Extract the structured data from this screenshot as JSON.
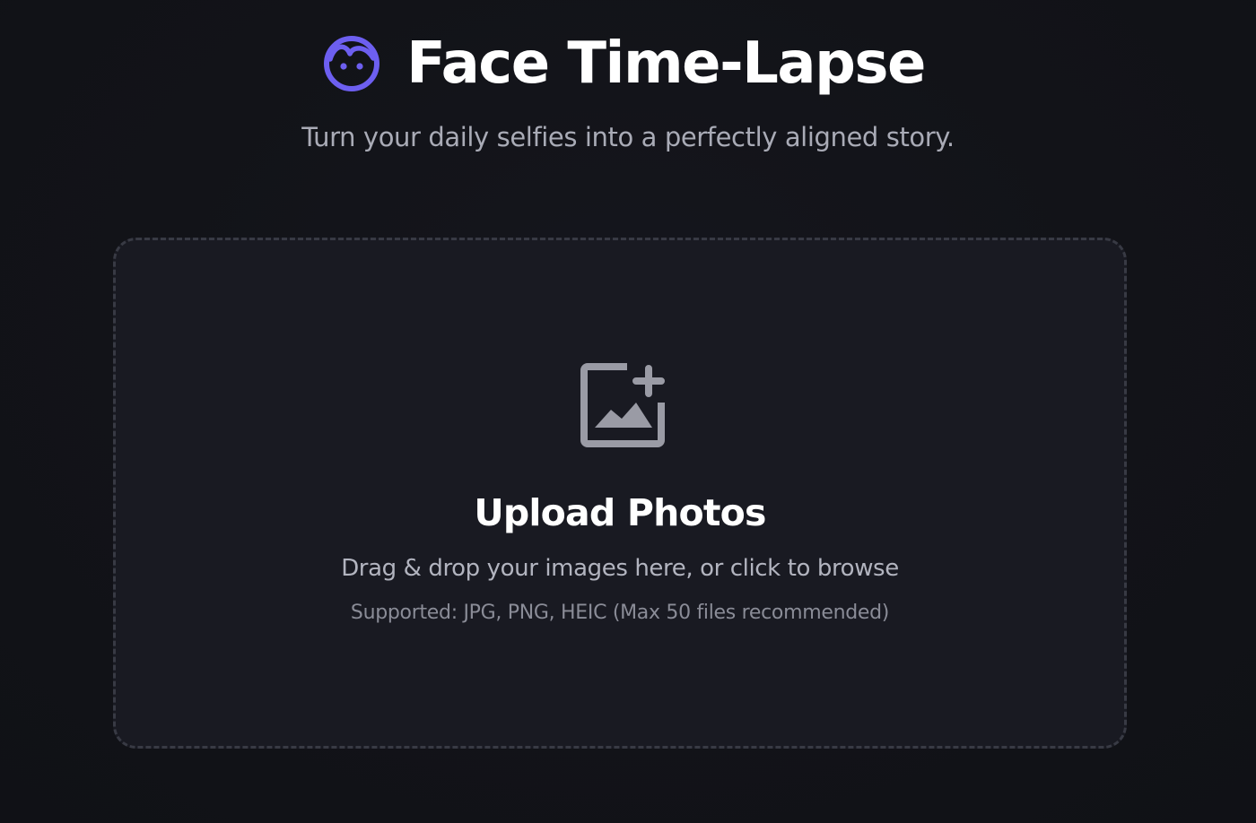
{
  "header": {
    "title": "Face Time-Lapse",
    "subtitle": "Turn your daily selfies into a perfectly aligned story.",
    "logo_icon": "face-icon"
  },
  "upload": {
    "icon": "add-photo-icon",
    "title": "Upload Photos",
    "description": "Drag & drop your images here, or click to browse",
    "hint": "Supported: JPG, PNG, HEIC (Max 50 files recommended)"
  },
  "colors": {
    "background": "#121318",
    "dropzone_background": "#191a22",
    "dropzone_border": "#383a44",
    "accent": "#6d5ff0",
    "icon_gray": "#9a9ba5",
    "title_text": "#ffffff",
    "muted_text": "#a9abb6"
  }
}
